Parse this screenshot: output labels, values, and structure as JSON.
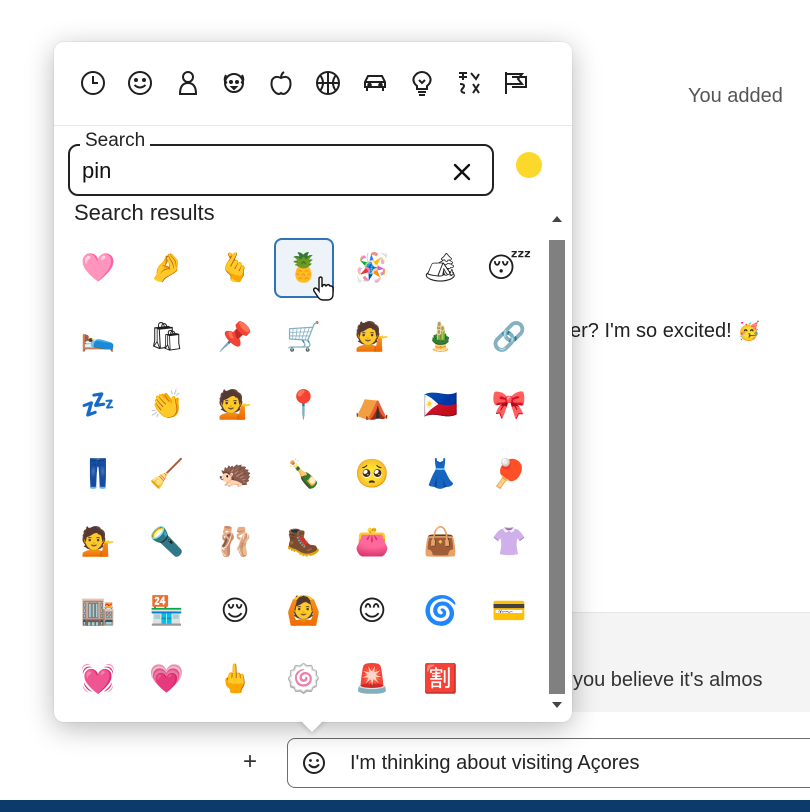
{
  "chat": {
    "line_added": "You added",
    "line_excited": "er? I'm so excited!",
    "line_excited_emoji": "🥳",
    "reply_quote": "you believe it's almos"
  },
  "composer": {
    "plus_label": "+",
    "message": "I'm thinking about visiting Açores",
    "smiley_icon": "smiley-icon"
  },
  "picker": {
    "categories": [
      {
        "icon": "recent-clock-icon"
      },
      {
        "icon": "smiley-icon"
      },
      {
        "icon": "person-icon"
      },
      {
        "icon": "animal-icon"
      },
      {
        "icon": "food-icon"
      },
      {
        "icon": "activity-ball-icon"
      },
      {
        "icon": "car-icon"
      },
      {
        "icon": "lightbulb-icon"
      },
      {
        "icon": "symbols-icon"
      },
      {
        "icon": "flags-icon"
      }
    ],
    "search": {
      "legend": "Search",
      "value": "pin",
      "clear_label": "✕"
    },
    "skin_tone_color": "#fcd82b",
    "results_title": "Search results",
    "selected_index": 3,
    "emojis": [
      "🩷",
      "🤌",
      "🫰",
      "🍍",
      "🪅",
      "🏕",
      "😴",
      "🛌",
      "🛍",
      "📌",
      "🛒",
      "💁",
      "🎍",
      "🔗",
      "💤",
      "👏",
      "💁",
      "📍",
      "⛺",
      "🇵🇭",
      "🎀",
      "👖",
      "🧹",
      "🦔",
      "🍾",
      "🥺",
      "👗",
      "🏓",
      "💁",
      "🔦",
      "🩰",
      "🥾",
      "👛",
      "👜",
      "👚",
      "🏬",
      "🏪",
      "😌",
      "🙆",
      "😊",
      "🌀",
      "💳",
      "💓",
      "💗",
      "🖕",
      "🍥",
      "🚨",
      "🈹"
    ],
    "accent": "#2e74b7"
  }
}
